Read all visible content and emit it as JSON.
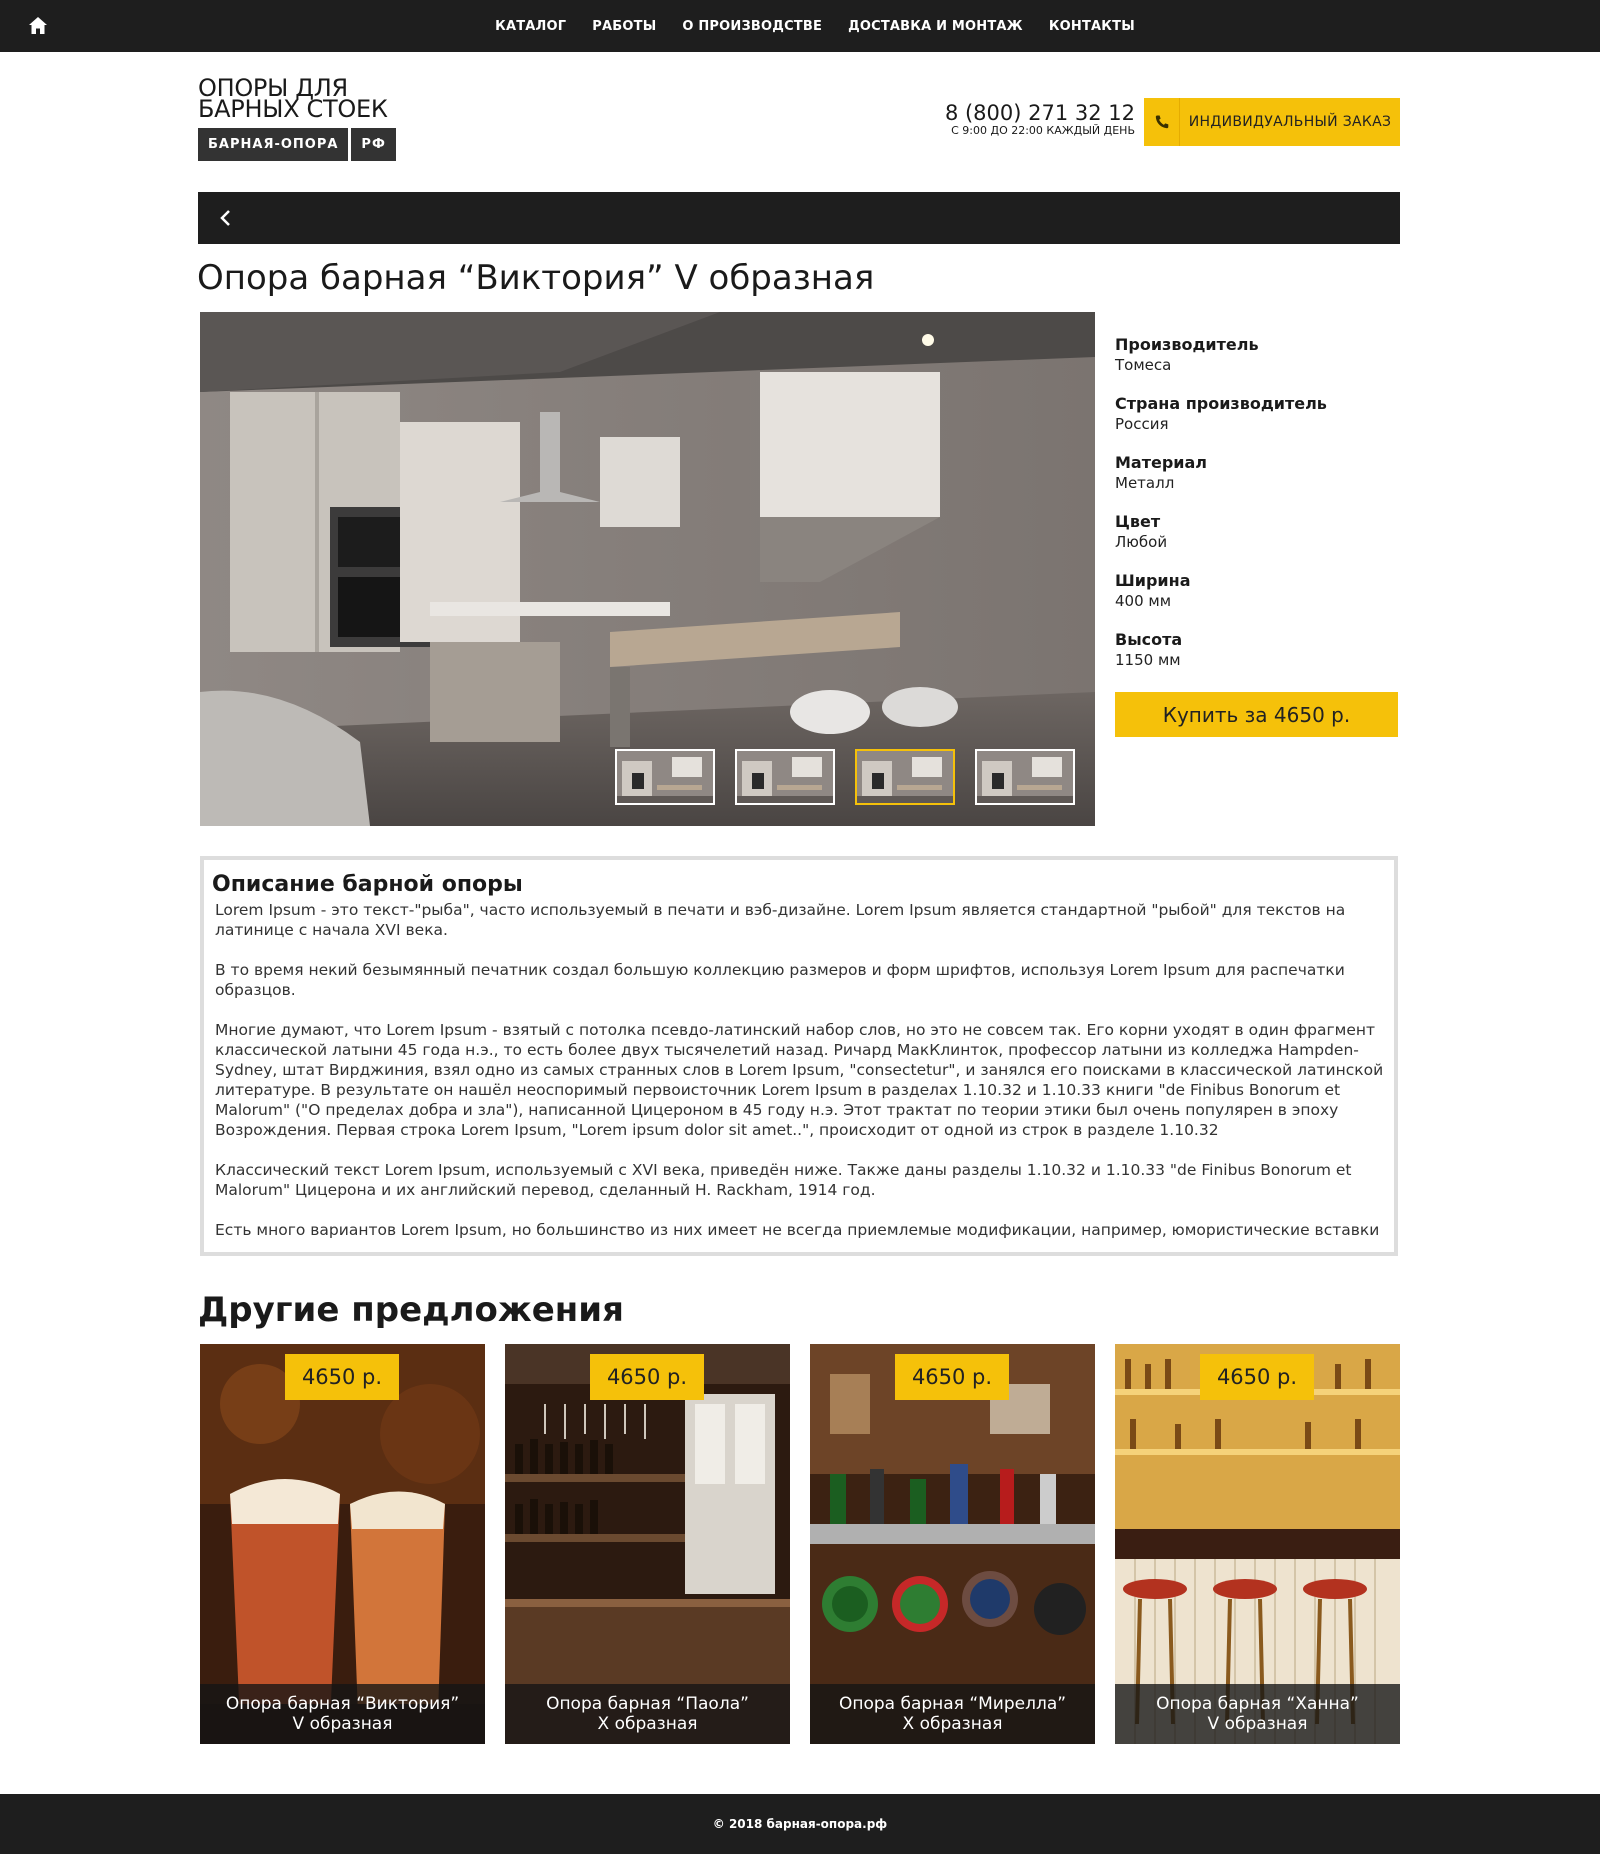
{
  "nav": {
    "items": [
      "КАТАЛОГ",
      "РАБОТЫ",
      "О ПРОИЗВОДСТВЕ",
      "ДОСТАВКА И МОНТАЖ",
      "КОНТАКТЫ"
    ],
    "home_icon": "home-icon"
  },
  "header": {
    "logo_line1": "ОПОРЫ ДЛЯ",
    "logo_line2": "БАРНЫХ СТОЕК",
    "logo_badge1": "БАРНАЯ-ОПОРА",
    "logo_badge2": "РФ",
    "phone": "8 (800) 271 32 12",
    "hours": "С 9:00 ДО 22:00 КАЖДЫЙ ДЕНЬ",
    "order_label": "ИНДИВИДУАЛЬНЫЙ ЗАКАЗ",
    "phone_icon": "phone-icon"
  },
  "product": {
    "title": "Опора барная “Виктория” V образная",
    "specs": [
      {
        "label": "Производитель",
        "value": "Томеса"
      },
      {
        "label": "Страна производитель",
        "value": "Россия"
      },
      {
        "label": "Материал",
        "value": "Металл"
      },
      {
        "label": "Цвет",
        "value": "Любой"
      },
      {
        "label": "Ширина",
        "value": "400 мм"
      },
      {
        "label": "Высота",
        "value": "1150 мм"
      }
    ],
    "buy_label": "Купить за 4650 р.",
    "active_thumb": 3
  },
  "description": {
    "title": "Описание барной опоры",
    "paragraphs": [
      "Lorem Ipsum - это текст-\"рыба\", часто используемый в печати и вэб-дизайне. Lorem Ipsum является стандартной \"рыбой\" для текстов на латинице с начала XVI века.",
      "В то время некий безымянный печатник создал большую коллекцию размеров и форм шрифтов, используя Lorem Ipsum для распечатки образцов.",
      "Многие думают, что Lorem Ipsum - взятый с потолка псевдо-латинский набор слов, но это не совсем так. Его корни уходят в один фрагмент классической латыни 45 года н.э., то есть более двух тысячелетий назад. Ричард МакКлинток, профессор латыни из колледжа Hampden-Sydney, штат Вирджиния, взял одно из самых странных слов в Lorem Ipsum, \"consectetur\", и занялся его поисками в классической латинской литературе. В результате он нашёл неоспоримый первоисточник Lorem Ipsum в разделах 1.10.32 и 1.10.33 книги \"de Finibus Bonorum et Malorum\" (\"О пределах добра и зла\"), написанной Цицероном в 45 году н.э. Этот трактат по теории этики был очень популярен в эпоху Возрождения. Первая строка Lorem Ipsum, \"Lorem ipsum dolor sit amet..\", происходит от одной из строк в разделе 1.10.32",
      "Классический текст Lorem Ipsum, используемый с XVI века, приведён ниже. Также даны разделы 1.10.32 и 1.10.33 \"de Finibus Bonorum et Malorum\" Цицерона и их английский перевод, сделанный H. Rackham, 1914 год.",
      "Есть много вариантов Lorem Ipsum, но большинство из них имеет не всегда приемлемые модификации, например, юмористические вставки"
    ]
  },
  "other": {
    "title": "Другие предложения",
    "cards": [
      {
        "price": "4650 р.",
        "line1": "Опора барная “Виктория”",
        "line2": "V образная"
      },
      {
        "price": "4650 р.",
        "line1": "Опора барная “Паола”",
        "line2": "X образная"
      },
      {
        "price": "4650 р.",
        "line1": "Опора барная “Мирелла”",
        "line2": "X образная"
      },
      {
        "price": "4650 р.",
        "line1": "Опора барная “Ханна”",
        "line2": "V образная"
      }
    ]
  },
  "footer": {
    "text": "© 2018 барная-опора.рф"
  }
}
